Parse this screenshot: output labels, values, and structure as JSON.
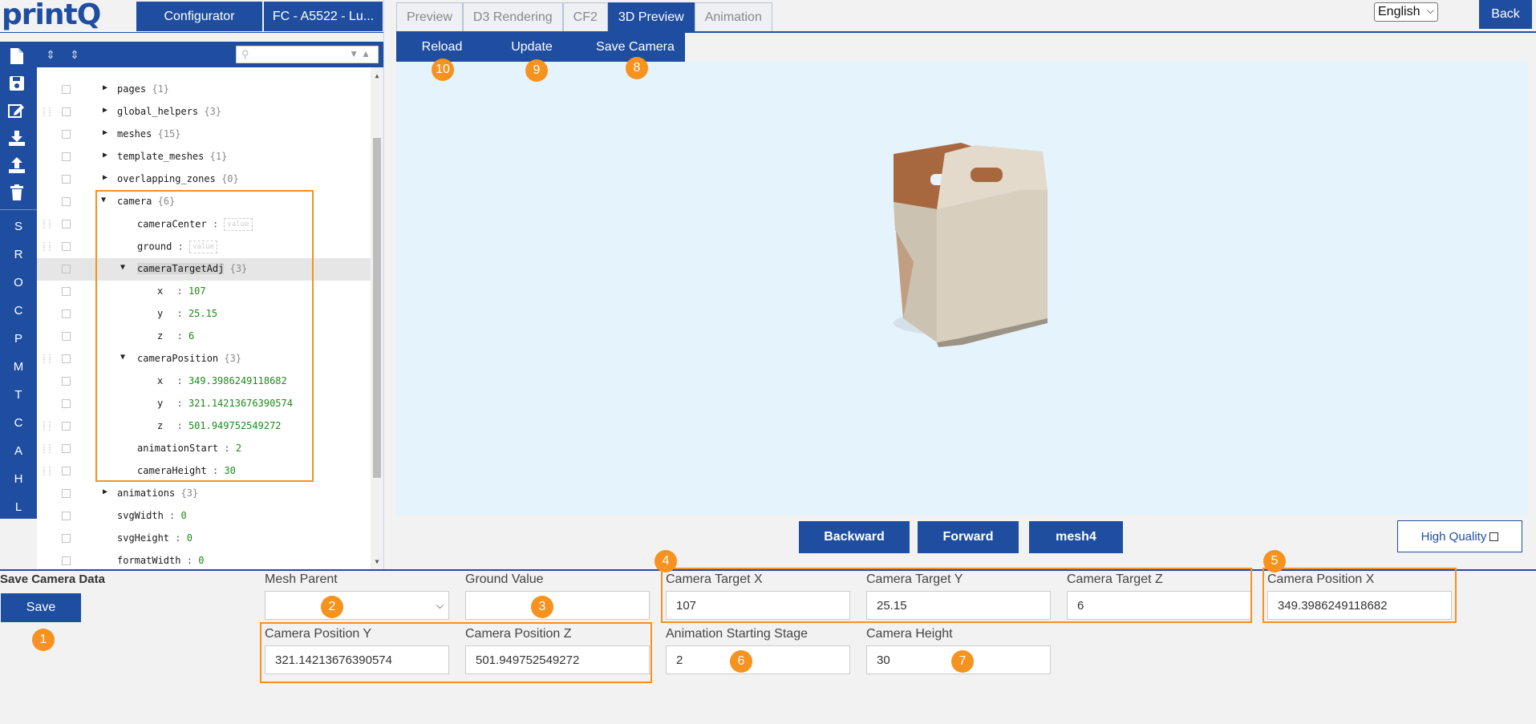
{
  "header": {
    "logo": "printQ",
    "configurator_label": "Configurator",
    "product_label": "FC - A5522 - Lu...",
    "language": "English",
    "back_label": "Back"
  },
  "tabs": [
    {
      "label": "Preview",
      "active": false
    },
    {
      "label": "D3 Rendering",
      "active": false
    },
    {
      "label": "CF2",
      "active": false
    },
    {
      "label": "3D Preview",
      "active": true
    },
    {
      "label": "Animation",
      "active": false
    }
  ],
  "toolbar": {
    "reload_label": "Reload",
    "update_label": "Update",
    "save_camera_label": "Save Camera"
  },
  "sidebar": {
    "icons": [
      "new-file-icon",
      "save-icon",
      "edit-icon",
      "download-icon",
      "upload-icon",
      "trash-icon"
    ],
    "letters": [
      "S",
      "R",
      "O",
      "C",
      "P",
      "M",
      "T",
      "C",
      "A",
      "H",
      "L"
    ]
  },
  "tree": {
    "rows": [
      {
        "key": "pages",
        "count": "{1}"
      },
      {
        "key": "global_helpers",
        "count": "{3}"
      },
      {
        "key": "meshes",
        "count": "{15}"
      },
      {
        "key": "template_meshes",
        "count": "{1}"
      },
      {
        "key": "overlapping_zones",
        "count": "{0}"
      },
      {
        "key": "camera",
        "count": "{6}"
      },
      {
        "key": "cameraCenter",
        "placeholder": "value"
      },
      {
        "key": "ground",
        "placeholder": "value"
      },
      {
        "key": "cameraTargetAdj",
        "count": "{3}"
      },
      {
        "key": "x",
        "value": "107"
      },
      {
        "key": "y",
        "value": "25.15"
      },
      {
        "key": "z",
        "value": "6"
      },
      {
        "key": "cameraPosition",
        "count": "{3}"
      },
      {
        "key": "x",
        "value": "349.3986249118682"
      },
      {
        "key": "y",
        "value": "321.14213676390574"
      },
      {
        "key": "z",
        "value": "501.949752549272"
      },
      {
        "key": "animationStart",
        "value": "2"
      },
      {
        "key": "cameraHeight",
        "value": "30"
      },
      {
        "key": "animations",
        "count": "{3}"
      },
      {
        "key": "svgWidth",
        "value": "0"
      },
      {
        "key": "svgHeight",
        "value": "0"
      },
      {
        "key": "formatWidth",
        "value": "0"
      }
    ]
  },
  "preview_controls": {
    "backward_label": "Backward",
    "forward_label": "Forward",
    "mesh_label": "mesh4",
    "high_quality_label": "High Quality"
  },
  "form": {
    "title": "Save Camera Data",
    "save_label": "Save",
    "mesh_parent": {
      "label": "Mesh Parent",
      "value": ""
    },
    "ground_value": {
      "label": "Ground Value",
      "value": ""
    },
    "camera_target_x": {
      "label": "Camera Target X",
      "value": "107"
    },
    "camera_target_y": {
      "label": "Camera Target Y",
      "value": "25.15"
    },
    "camera_target_z": {
      "label": "Camera Target Z",
      "value": "6"
    },
    "camera_position_x": {
      "label": "Camera Position X",
      "value": "349.3986249118682"
    },
    "camera_position_y": {
      "label": "Camera Position Y",
      "value": "321.14213676390574"
    },
    "camera_position_z": {
      "label": "Camera Position Z",
      "value": "501.949752549272"
    },
    "animation_starting_stage": {
      "label": "Animation Starting Stage",
      "value": "2"
    },
    "camera_height": {
      "label": "Camera Height",
      "value": "30"
    }
  },
  "badges": [
    "1",
    "2",
    "3",
    "4",
    "5",
    "6",
    "7",
    "8",
    "9",
    "10"
  ],
  "colors": {
    "accent": "#1f4ea1",
    "badge": "#f6921e",
    "viewport_bg": "#e5f3fc"
  }
}
